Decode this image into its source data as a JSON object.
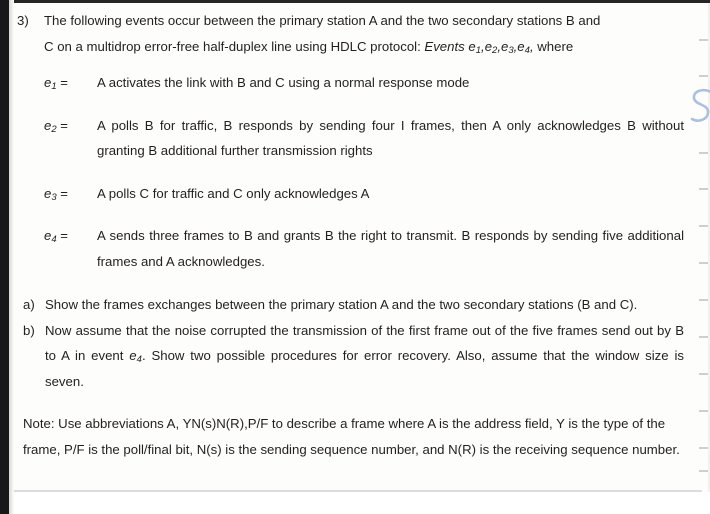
{
  "document": {
    "question_number": "3)",
    "intro": {
      "line_1": "The following events occur between the primary station A and the two secondary stations B and",
      "line_2_plain_start": "C on a multidrop error-free half-duplex line using HDLC protocol: ",
      "line_2_italic": "Events e",
      "line_2_sub_1": "1",
      "line_2_sep_1": ",e",
      "line_2_sub_2": "2",
      "line_2_sep_2": ",e",
      "line_2_sub_3": "3",
      "line_2_sep_3": ",e",
      "line_2_sub_4": "4",
      "line_2_sep_4": ",",
      "line_2_plain_end": " where"
    },
    "events": [
      {
        "symbol": "e",
        "subscript": "1",
        "equals": " =",
        "text": "A activates the link with B and C using a normal response mode"
      },
      {
        "symbol": "e",
        "subscript": "2",
        "equals": " =",
        "text": "A polls B for traffic, B responds by sending four I frames, then A only acknowledges B without granting B additional further transmission rights"
      },
      {
        "symbol": "e",
        "subscript": "3",
        "equals": " =",
        "text": "A polls C for traffic and C only acknowledges A"
      },
      {
        "symbol": "e",
        "subscript": "4",
        "equals": " =",
        "text": "A sends three frames to B and grants B the right to transmit. B responds by sending five additional frames and A acknowledges."
      }
    ],
    "subquestions": [
      {
        "marker": "a)",
        "text": "Show the frames exchanges between the primary station A and the two secondary stations (B and C)."
      },
      {
        "marker": "b)",
        "text_before_symbol": "Now assume that the noise corrupted the transmission of the first frame out of the five frames send out by B to A in event ",
        "symbol": "e",
        "subscript": "4",
        "text_after_symbol": ". Show two possible procedures for error recovery. Also, assume that the window size is seven."
      }
    ],
    "note": {
      "text": "Note: Use abbreviations A, YN(s)N(R),P/F to describe a frame where A is the address field, Y is the type of the frame, P/F is the poll/final bit, N(s) is the sending sequence number, and N(R) is the receiving sequence number."
    },
    "annotations": {
      "handwritten_mark": "S"
    },
    "colors": {
      "text": "#231f20",
      "page_background": "#fdfdfb",
      "left_gutter": "#18181a",
      "divider": "#dcdcdc",
      "annotation_blue": "#a9bfe8",
      "margin_tick": "#cfcfcf"
    }
  }
}
